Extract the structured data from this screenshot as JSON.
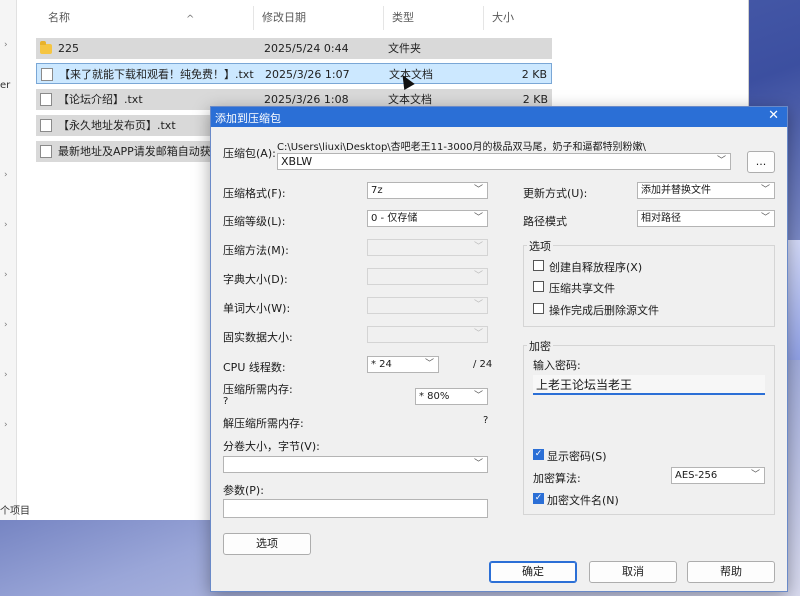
{
  "explorer": {
    "columns": {
      "name": "名称",
      "date": "修改日期",
      "type": "类型",
      "size": "大小"
    },
    "nav_label": "er",
    "status": "个项目",
    "rows": [
      {
        "name": "225",
        "date": "2025/5/24 0:44",
        "type": "文件夹",
        "size": "",
        "icon": "folder-icon"
      },
      {
        "name": "【来了就能下载和观看！纯免费！】.txt",
        "date": "2025/3/26 1:07",
        "type": "文本文档",
        "size": "2 KB",
        "icon": "text-file-icon"
      },
      {
        "name": "【论坛介绍】.txt",
        "date": "2025/3/26 1:08",
        "type": "文本文档",
        "size": "2 KB",
        "icon": "text-file-icon"
      },
      {
        "name": "【永久地址发布页】.txt",
        "date": "",
        "type": "",
        "size": "",
        "icon": "text-file-icon"
      },
      {
        "name": "最新地址及APP请发邮箱自动获取",
        "date": "",
        "type": "",
        "size": "",
        "icon": "text-file-icon"
      }
    ]
  },
  "dialog": {
    "title": "添加到压缩包",
    "archive_label": "压缩包(A):",
    "archive_path": "C:\\Users\\liuxi\\Desktop\\杏吧老王11-3000月的极品双马尾，奶子和逼都特别粉嫩\\",
    "archive_name": "XBLW",
    "browse_label": "...",
    "format_label": "压缩格式(F):",
    "format_value": "7z",
    "level_label": "压缩等级(L):",
    "level_value": "0 - 仅存储",
    "method_label": "压缩方法(M):",
    "dict_label": "字典大小(D):",
    "word_label": "单词大小(W):",
    "solid_label": "固实数据大小:",
    "cpu_label": "CPU 线程数:",
    "cpu_value": "* 24",
    "cpu_total": "/ 24",
    "mem_label": "压缩所需内存:",
    "mem_question": "?",
    "mem_value": "* 80%",
    "dmem_label": "解压缩所需内存:",
    "dmem_value": "?",
    "split_label": "分卷大小，字节(V):",
    "params_label": "参数(P):",
    "options_button": "选项",
    "update_label": "更新方式(U):",
    "update_value": "添加并替换文件",
    "path_label": "路径模式",
    "path_value": "相对路径",
    "options_group": "选项",
    "opt_sfx": "创建自释放程序(X)",
    "opt_shared": "压缩共享文件",
    "opt_delete": "操作完成后删除源文件",
    "encrypt_group": "加密",
    "pwd_label": "输入密码:",
    "pwd_value": "上老王论坛当老王",
    "show_pwd": "显示密码(S)",
    "enc_method_label": "加密算法:",
    "enc_method_value": "AES-256",
    "enc_names": "加密文件名(N)",
    "ok": "确定",
    "cancel": "取消",
    "help": "帮助",
    "check_mark": "✓",
    "close_glyph": "✕",
    "arrow_glyph": "﹀"
  }
}
